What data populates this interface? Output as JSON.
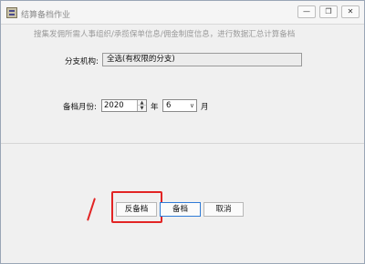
{
  "window": {
    "title": "结算备档作业",
    "minimize_glyph": "—",
    "restore_glyph": "❐",
    "close_glyph": "✕"
  },
  "hint": "搜集发佣所需人事组织/承揽保单信息/佣金制度信息，进行数据汇总计算备档",
  "form": {
    "org_label": "分支机构:",
    "org_value": "全选(有权限的分支)",
    "period_label": "备档月份:",
    "year_value": "2020",
    "year_unit": "年",
    "month_value": "6",
    "month_unit": "月"
  },
  "buttons": {
    "unarchive": "反备档",
    "archive": "备档",
    "cancel": "取消"
  },
  "icons": {
    "app": "app-icon",
    "spin_up": "▲",
    "spin_down": "▼",
    "dropdown": "∨"
  },
  "colors": {
    "annotation": "#e22424",
    "focus_border": "#2f7bd6"
  }
}
